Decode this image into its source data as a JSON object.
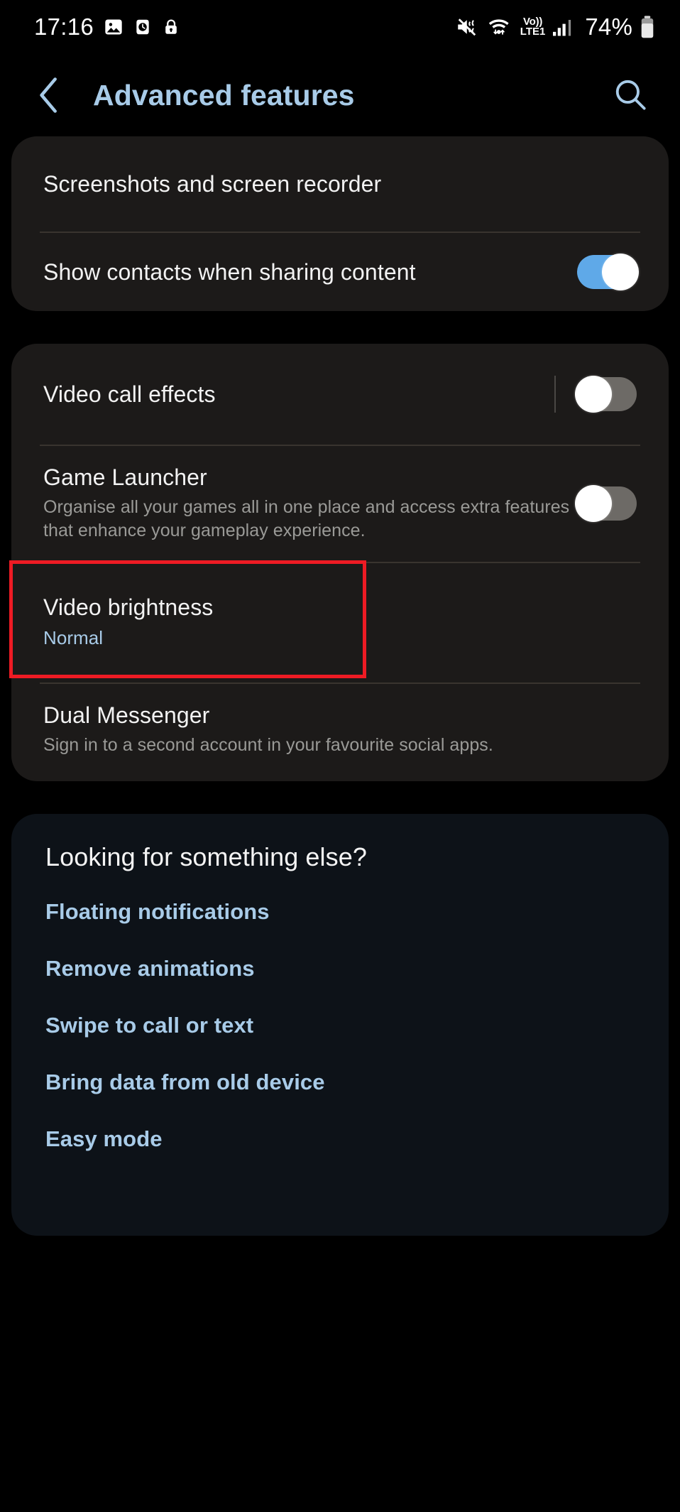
{
  "status_bar": {
    "time": "17:16",
    "left_icons": [
      "image-icon",
      "alarm-clock-icon",
      "lock-icon"
    ],
    "right_icons": [
      "mute-icon",
      "wifi-icon",
      "signal-bars-icon"
    ],
    "network_label_top": "Vo))",
    "network_label_bottom": "LTE1",
    "battery_percent": "74%"
  },
  "header": {
    "back_icon": "chevron-left-icon",
    "title": "Advanced features",
    "search_icon": "search-icon"
  },
  "colors": {
    "accent_blue": "#a8cbe8",
    "toggle_on": "#5fa9e8",
    "toggle_off": "#6d6a66",
    "card_bg": "#1c1a19",
    "links_card_bg": "#0d1218",
    "highlight_border": "#ee1b24",
    "page_bg": "#000000"
  },
  "cards": [
    {
      "rows": [
        {
          "title": "Screenshots and screen recorder"
        },
        {
          "title": "Show contacts when sharing content",
          "toggle": "on"
        }
      ]
    },
    {
      "rows": [
        {
          "title": "Video call effects",
          "toggle": "off"
        },
        {
          "title": "Game Launcher",
          "subtitle": "Organise all your games all in one place and access extra features that enhance your gameplay experience.",
          "toggle": "off"
        },
        {
          "title": "Video brightness",
          "subtitle": "Normal",
          "highlighted": true
        },
        {
          "title": "Dual Messenger",
          "subtitle": "Sign in to a second account in your favourite social apps."
        }
      ]
    }
  ],
  "links_section": {
    "heading": "Looking for something else?",
    "links": [
      "Floating notifications",
      "Remove animations",
      "Swipe to call or text",
      "Bring data from old device",
      "Easy mode"
    ]
  }
}
